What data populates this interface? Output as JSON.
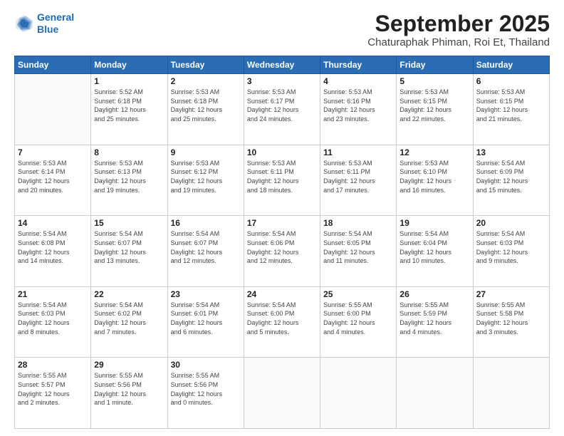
{
  "header": {
    "logo_line1": "General",
    "logo_line2": "Blue",
    "title": "September 2025",
    "subtitle": "Chaturaphak Phiman, Roi Et, Thailand"
  },
  "days_of_week": [
    "Sunday",
    "Monday",
    "Tuesday",
    "Wednesday",
    "Thursday",
    "Friday",
    "Saturday"
  ],
  "weeks": [
    [
      {
        "day": "",
        "info": ""
      },
      {
        "day": "1",
        "info": "Sunrise: 5:52 AM\nSunset: 6:18 PM\nDaylight: 12 hours\nand 25 minutes."
      },
      {
        "day": "2",
        "info": "Sunrise: 5:53 AM\nSunset: 6:18 PM\nDaylight: 12 hours\nand 25 minutes."
      },
      {
        "day": "3",
        "info": "Sunrise: 5:53 AM\nSunset: 6:17 PM\nDaylight: 12 hours\nand 24 minutes."
      },
      {
        "day": "4",
        "info": "Sunrise: 5:53 AM\nSunset: 6:16 PM\nDaylight: 12 hours\nand 23 minutes."
      },
      {
        "day": "5",
        "info": "Sunrise: 5:53 AM\nSunset: 6:15 PM\nDaylight: 12 hours\nand 22 minutes."
      },
      {
        "day": "6",
        "info": "Sunrise: 5:53 AM\nSunset: 6:15 PM\nDaylight: 12 hours\nand 21 minutes."
      }
    ],
    [
      {
        "day": "7",
        "info": "Sunrise: 5:53 AM\nSunset: 6:14 PM\nDaylight: 12 hours\nand 20 minutes."
      },
      {
        "day": "8",
        "info": "Sunrise: 5:53 AM\nSunset: 6:13 PM\nDaylight: 12 hours\nand 19 minutes."
      },
      {
        "day": "9",
        "info": "Sunrise: 5:53 AM\nSunset: 6:12 PM\nDaylight: 12 hours\nand 19 minutes."
      },
      {
        "day": "10",
        "info": "Sunrise: 5:53 AM\nSunset: 6:11 PM\nDaylight: 12 hours\nand 18 minutes."
      },
      {
        "day": "11",
        "info": "Sunrise: 5:53 AM\nSunset: 6:11 PM\nDaylight: 12 hours\nand 17 minutes."
      },
      {
        "day": "12",
        "info": "Sunrise: 5:53 AM\nSunset: 6:10 PM\nDaylight: 12 hours\nand 16 minutes."
      },
      {
        "day": "13",
        "info": "Sunrise: 5:54 AM\nSunset: 6:09 PM\nDaylight: 12 hours\nand 15 minutes."
      }
    ],
    [
      {
        "day": "14",
        "info": "Sunrise: 5:54 AM\nSunset: 6:08 PM\nDaylight: 12 hours\nand 14 minutes."
      },
      {
        "day": "15",
        "info": "Sunrise: 5:54 AM\nSunset: 6:07 PM\nDaylight: 12 hours\nand 13 minutes."
      },
      {
        "day": "16",
        "info": "Sunrise: 5:54 AM\nSunset: 6:07 PM\nDaylight: 12 hours\nand 12 minutes."
      },
      {
        "day": "17",
        "info": "Sunrise: 5:54 AM\nSunset: 6:06 PM\nDaylight: 12 hours\nand 12 minutes."
      },
      {
        "day": "18",
        "info": "Sunrise: 5:54 AM\nSunset: 6:05 PM\nDaylight: 12 hours\nand 11 minutes."
      },
      {
        "day": "19",
        "info": "Sunrise: 5:54 AM\nSunset: 6:04 PM\nDaylight: 12 hours\nand 10 minutes."
      },
      {
        "day": "20",
        "info": "Sunrise: 5:54 AM\nSunset: 6:03 PM\nDaylight: 12 hours\nand 9 minutes."
      }
    ],
    [
      {
        "day": "21",
        "info": "Sunrise: 5:54 AM\nSunset: 6:03 PM\nDaylight: 12 hours\nand 8 minutes."
      },
      {
        "day": "22",
        "info": "Sunrise: 5:54 AM\nSunset: 6:02 PM\nDaylight: 12 hours\nand 7 minutes."
      },
      {
        "day": "23",
        "info": "Sunrise: 5:54 AM\nSunset: 6:01 PM\nDaylight: 12 hours\nand 6 minutes."
      },
      {
        "day": "24",
        "info": "Sunrise: 5:54 AM\nSunset: 6:00 PM\nDaylight: 12 hours\nand 5 minutes."
      },
      {
        "day": "25",
        "info": "Sunrise: 5:55 AM\nSunset: 6:00 PM\nDaylight: 12 hours\nand 4 minutes."
      },
      {
        "day": "26",
        "info": "Sunrise: 5:55 AM\nSunset: 5:59 PM\nDaylight: 12 hours\nand 4 minutes."
      },
      {
        "day": "27",
        "info": "Sunrise: 5:55 AM\nSunset: 5:58 PM\nDaylight: 12 hours\nand 3 minutes."
      }
    ],
    [
      {
        "day": "28",
        "info": "Sunrise: 5:55 AM\nSunset: 5:57 PM\nDaylight: 12 hours\nand 2 minutes."
      },
      {
        "day": "29",
        "info": "Sunrise: 5:55 AM\nSunset: 5:56 PM\nDaylight: 12 hours\nand 1 minute."
      },
      {
        "day": "30",
        "info": "Sunrise: 5:55 AM\nSunset: 5:56 PM\nDaylight: 12 hours\nand 0 minutes."
      },
      {
        "day": "",
        "info": ""
      },
      {
        "day": "",
        "info": ""
      },
      {
        "day": "",
        "info": ""
      },
      {
        "day": "",
        "info": ""
      }
    ]
  ]
}
